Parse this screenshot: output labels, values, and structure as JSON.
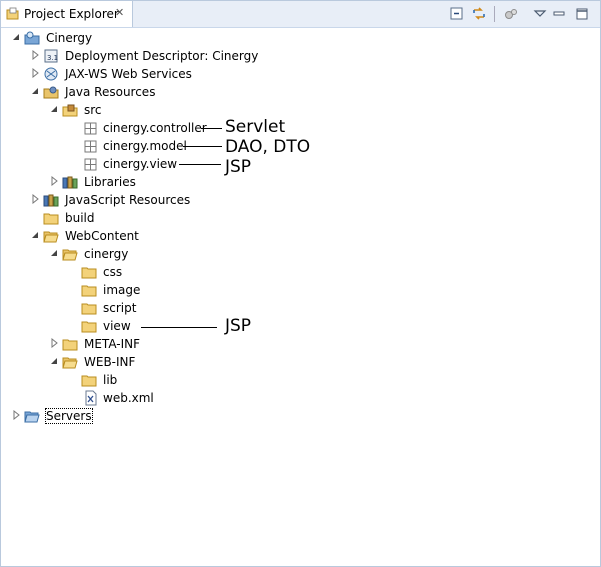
{
  "window": {
    "tab_title": "Project Explorer",
    "close_glyph": "✕"
  },
  "toolbar": {
    "collapse_all": "collapse-all-icon",
    "link_editor": "link-with-editor-icon",
    "filters": "filters-icon",
    "view_menu": "view-menu-icon",
    "minimize": "minimize-icon",
    "maximize": "maximize-icon"
  },
  "tree": {
    "project": "Cinergy",
    "deployment_descriptor": "Deployment Descriptor: Cinergy",
    "jaxws": "JAX-WS Web Services",
    "java_resources": "Java Resources",
    "src": "src",
    "pkg_controller": "cinergy.controller",
    "pkg_model": "cinergy.model",
    "pkg_view": "cinergy.view",
    "libraries": "Libraries",
    "js_resources": "JavaScript Resources",
    "build": "build",
    "webcontent": "WebContent",
    "cinergy_folder": "cinergy",
    "css": "css",
    "image": "image",
    "script": "script",
    "view": "view",
    "meta_inf": "META-INF",
    "web_inf": "WEB-INF",
    "lib": "lib",
    "web_xml": "web.xml",
    "servers": "Servers"
  },
  "annotations": {
    "controller": "Servlet",
    "model": "DAO, DTO",
    "view_pkg": "JSP",
    "view_folder": "JSP"
  }
}
